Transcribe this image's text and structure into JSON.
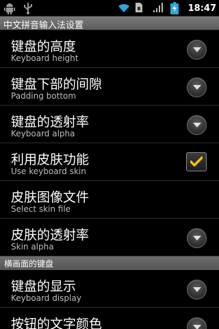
{
  "status_bar": {
    "time": "18:47",
    "left_icons": [
      "android-debug-icon",
      "usb-icon"
    ],
    "right_icons": [
      "wifi-icon",
      "sim-icon",
      "signal-icon",
      "battery-charging-icon"
    ]
  },
  "title": "中文拼音输入法设置",
  "preferences": [
    {
      "title": "键盘的高度",
      "summary": "Keyboard height",
      "widget": "dropdown"
    },
    {
      "title": "键盘下部的间隙",
      "summary": "Padding bottom",
      "widget": "dropdown"
    },
    {
      "title": "键盘的透射率",
      "summary": "Keyboard alpha",
      "widget": "dropdown"
    },
    {
      "title": "利用皮肤功能",
      "summary": "Use keyboard skin",
      "widget": "checkbox",
      "checked": true
    },
    {
      "title": "皮肤图像文件",
      "summary": "Select skin file",
      "widget": "none"
    },
    {
      "title": "皮肤的透射率",
      "summary": "Skin alpha",
      "widget": "dropdown"
    }
  ],
  "category": "横画面的键盘",
  "landscape_preferences": [
    {
      "title": "键盘的显示",
      "summary": "Keyboard display",
      "widget": "dropdown"
    },
    {
      "title": "按钮的文字颜色",
      "summary": "",
      "widget": "dropdown"
    }
  ],
  "colors": {
    "check_accent": "#f2c500",
    "title_bar": "#6a6a6a",
    "divider": "#2e2e2e"
  }
}
